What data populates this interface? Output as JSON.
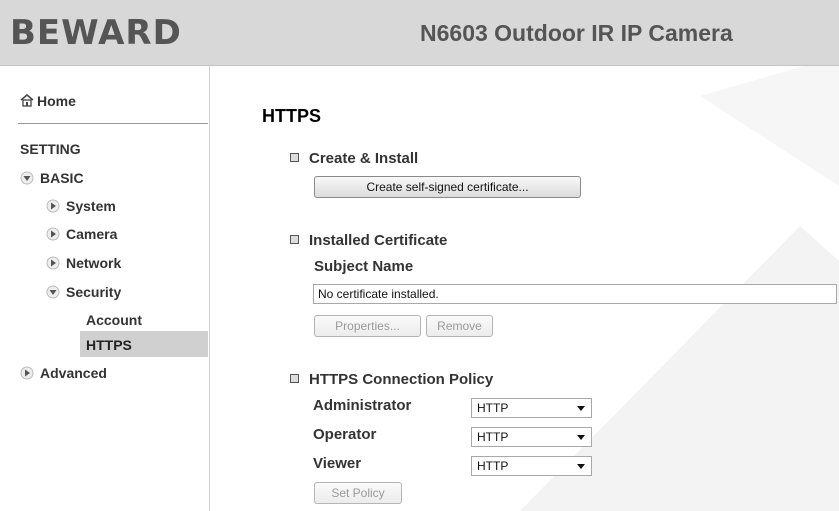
{
  "header": {
    "logo": "BEWARD",
    "product_title": "N6603 Outdoor IR IP Camera"
  },
  "sidebar": {
    "home": "Home",
    "setting": "SETTING",
    "basic": "BASIC",
    "items": {
      "system": "System",
      "camera": "Camera",
      "network": "Network",
      "security": "Security",
      "account": "Account",
      "https": "HTTPS",
      "advanced": "Advanced"
    },
    "selected": "HTTPS"
  },
  "main": {
    "title": "HTTPS",
    "create_install": {
      "title": "Create & Install",
      "button": "Create self-signed certificate..."
    },
    "installed": {
      "title": "Installed Certificate",
      "subject_label": "Subject Name",
      "subject_value": "No certificate installed.",
      "properties_button": "Properties...",
      "remove_button": "Remove"
    },
    "policy": {
      "title": "HTTPS Connection Policy",
      "rows": [
        {
          "label": "Administrator",
          "value": "HTTP"
        },
        {
          "label": "Operator",
          "value": "HTTP"
        },
        {
          "label": "Viewer",
          "value": "HTTP"
        }
      ],
      "set_button": "Set Policy"
    }
  },
  "colors": {
    "header_bg": "#d8d8d8",
    "selected_bg": "#d0d0d0",
    "text": "#333333"
  },
  "icons": [
    "home-icon",
    "expanded-triangle-icon",
    "collapsed-triangle-icon",
    "bullet-square-icon",
    "dropdown-arrow-icon"
  ]
}
